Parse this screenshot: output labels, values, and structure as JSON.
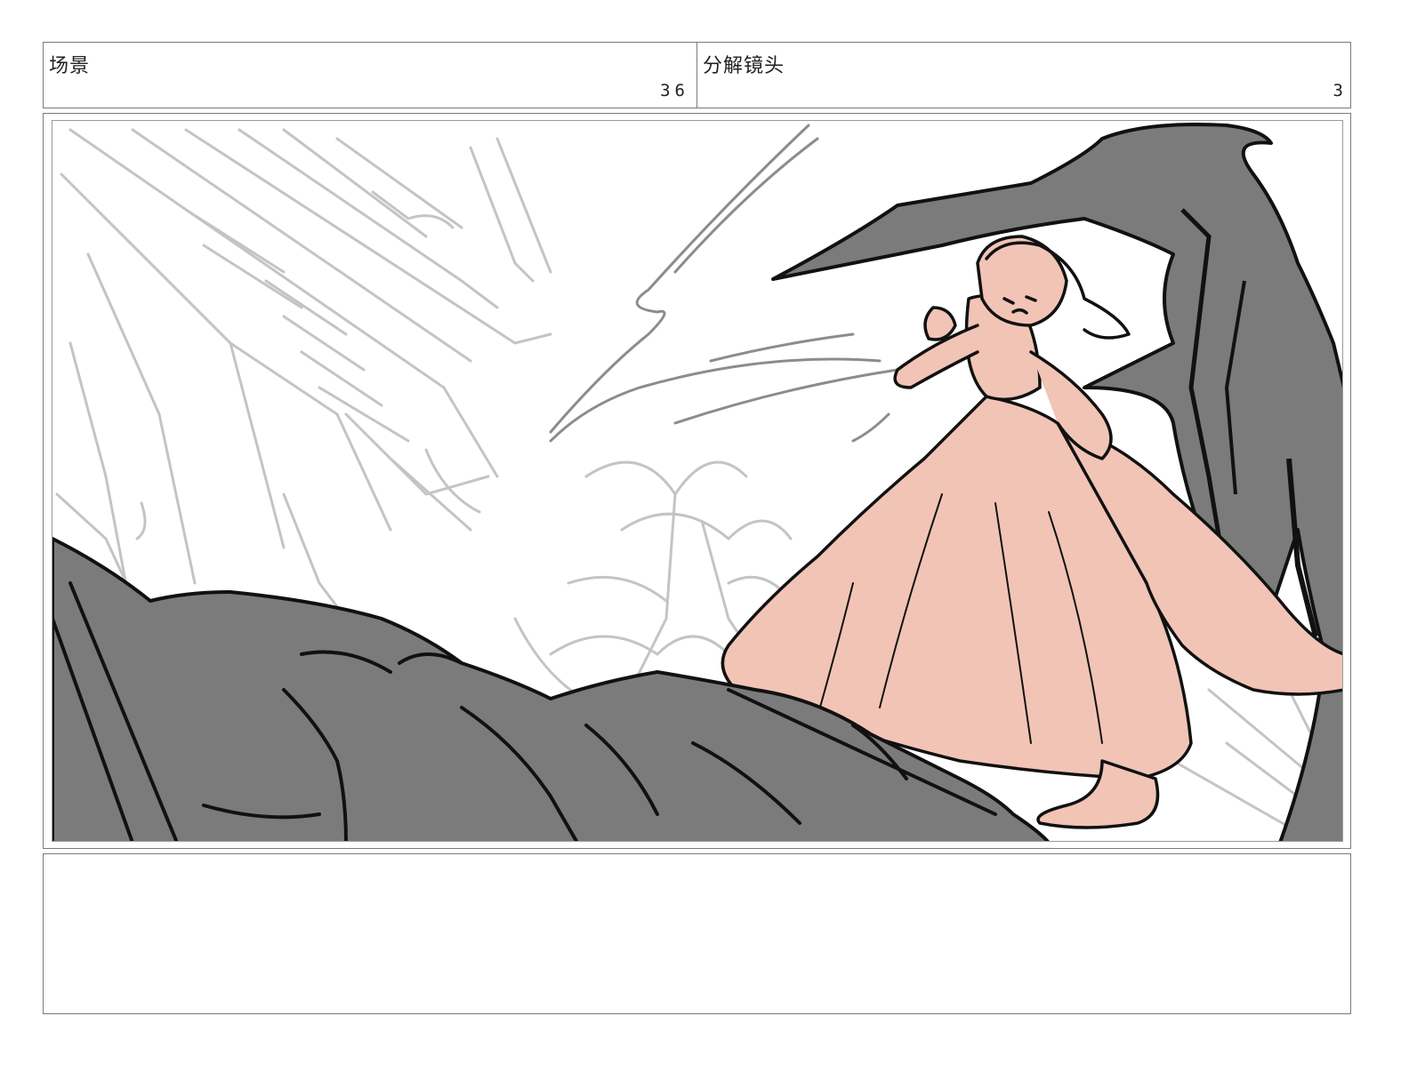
{
  "header": {
    "scene_label": "场景",
    "scene_number": "36",
    "shot_label": "分解镜头",
    "shot_number": "3"
  },
  "panel": {
    "colors": {
      "sketch_gray": "#c4c4c4",
      "dark_fill": "#7b7b7b",
      "skin_pink": "#f1c4b6",
      "ink": "#111111"
    }
  },
  "notes": {
    "text": ""
  }
}
